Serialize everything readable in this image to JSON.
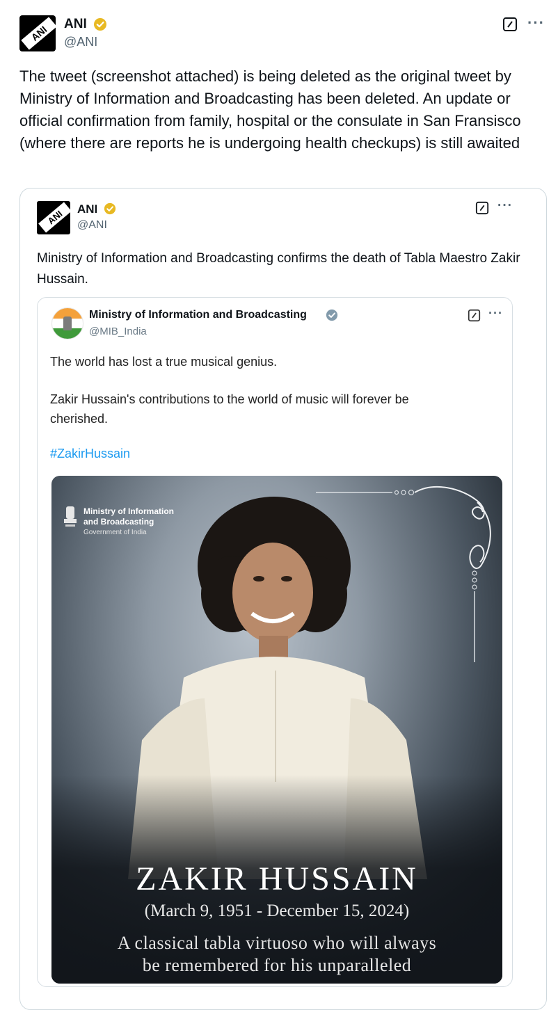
{
  "main_tweet": {
    "avatar_text": "ANI",
    "name": "ANI",
    "handle": "@ANI",
    "text": "The tweet (screenshot attached) is being deleted as the original tweet by Ministry of Information and Broadcasting has been deleted. An update or official confirmation from family, hospital or the consulate in San Fransisco (where there are reports he is undergoing health checkups) is still awaited",
    "more": "···"
  },
  "quoted_tweet": {
    "avatar_text": "ANI",
    "name": "ANI",
    "handle": "@ANI",
    "text": "Ministry of Information and Broadcasting confirms the death of Tabla Maestro Zakir Hussain.",
    "more": "···"
  },
  "inner_tweet": {
    "name": "Ministry of Information and Broadcasting",
    "handle": "@MIB_India",
    "line1": "The world has lost a true musical genius.",
    "line2": "Zakir Hussain's contributions to the world of music will forever be cherished.",
    "hashtag": "#ZakirHussain",
    "more": "···"
  },
  "poster": {
    "org_line1": "Ministry of Information",
    "org_line2": "and Broadcasting",
    "gov": "Government of India",
    "name": "ZAKIR HUSSAIN",
    "dates": "(March 9, 1951 - December 15, 2024)",
    "tagline1": "A classical tabla virtuoso who will always",
    "tagline2": "be remembered for his unparalleled"
  },
  "colors": {
    "verified_gold": "#e8b923",
    "verified_gray": "#829aab",
    "link_blue": "#1d9bf0",
    "muted_text": "#536471"
  },
  "icons": [
    "grok-icon",
    "more-icon",
    "verified-gold-icon",
    "verified-gray-icon",
    "emblem-icon"
  ]
}
